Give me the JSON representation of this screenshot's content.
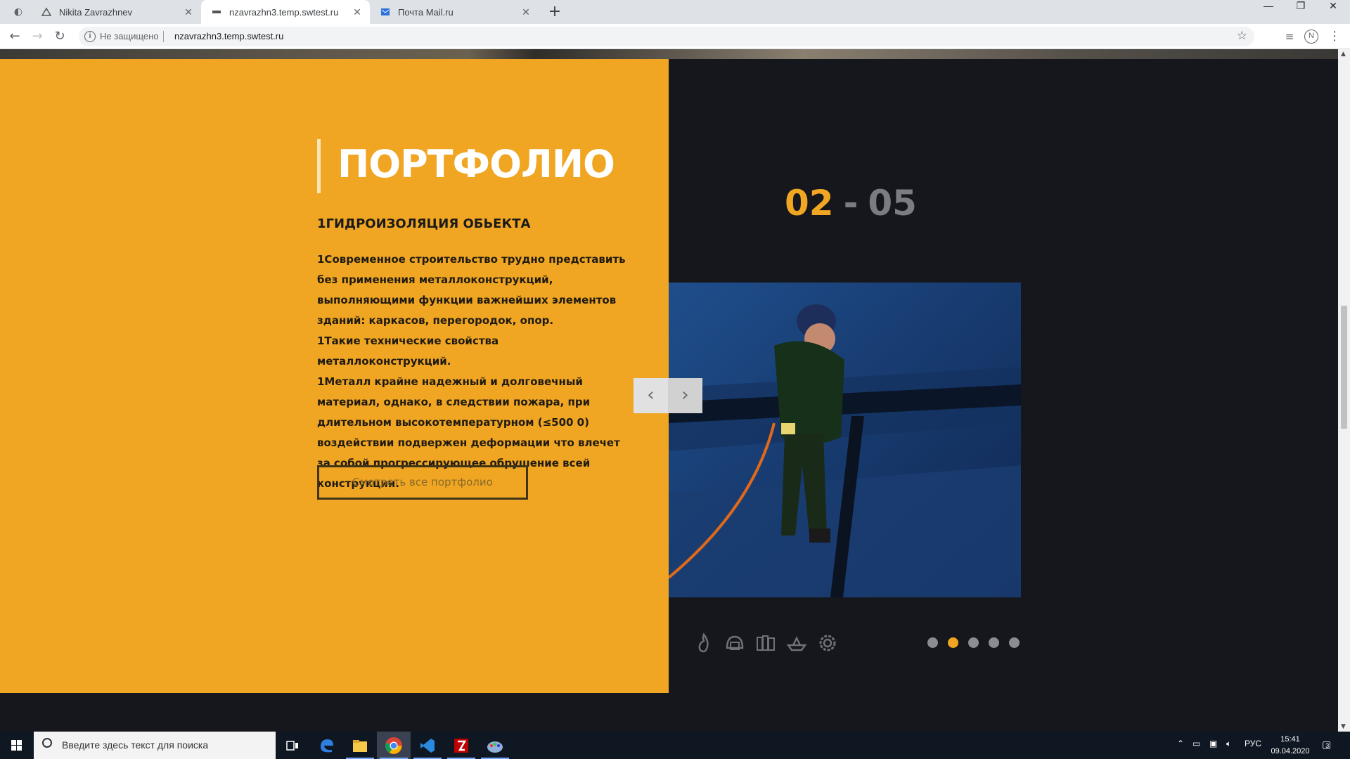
{
  "browser": {
    "tabs": [
      {
        "title": "Nikita Zavrazhnev",
        "active": false,
        "icon": "triangle-icon"
      },
      {
        "title": "nzavrazhn3.temp.swtest.ru",
        "active": true,
        "icon": "flag-icon"
      },
      {
        "title": "Почта Mail.ru",
        "active": false,
        "icon": "mail-icon"
      }
    ],
    "security_label": "Не защищено",
    "url": "nzavrazhn3.temp.swtest.ru",
    "profile_initial": "N"
  },
  "portfolio": {
    "heading": "ПОРТФОЛИО",
    "project_title": "1ГИДРОИЗОЛЯЦИЯ ОБЬЕКТА",
    "description": [
      "1Современное строительство трудно представить без применения металлоконструкций, выполняющими функции важнейших элементов зданий: каркасов, перегородок, опор.",
      "1Такие технические свойства металлоконструкций.",
      "1Металл крайне надежный и долговечный материал, однако, в следствии пожара, при длительном высокотемпературном (≤500 0) воздействии подвержен деформации что влечет за собой прогрессирующее обрушение всей конструкции."
    ],
    "view_all_label": "Смотреть все портфолио",
    "counter_current": "02",
    "counter_separator": "-",
    "counter_total": "05",
    "accent_color": "#f0a622",
    "category_icons": [
      "flame-icon",
      "helmet-icon",
      "books-icon",
      "ship-icon",
      "gear-icon"
    ],
    "slides_total": 5,
    "active_slide_index": 1
  },
  "taskbar": {
    "search_placeholder": "Введите здесь текст для поиска",
    "language": "РУС",
    "time": "15:41",
    "date": "09.04.2020",
    "notification_count": "3"
  }
}
